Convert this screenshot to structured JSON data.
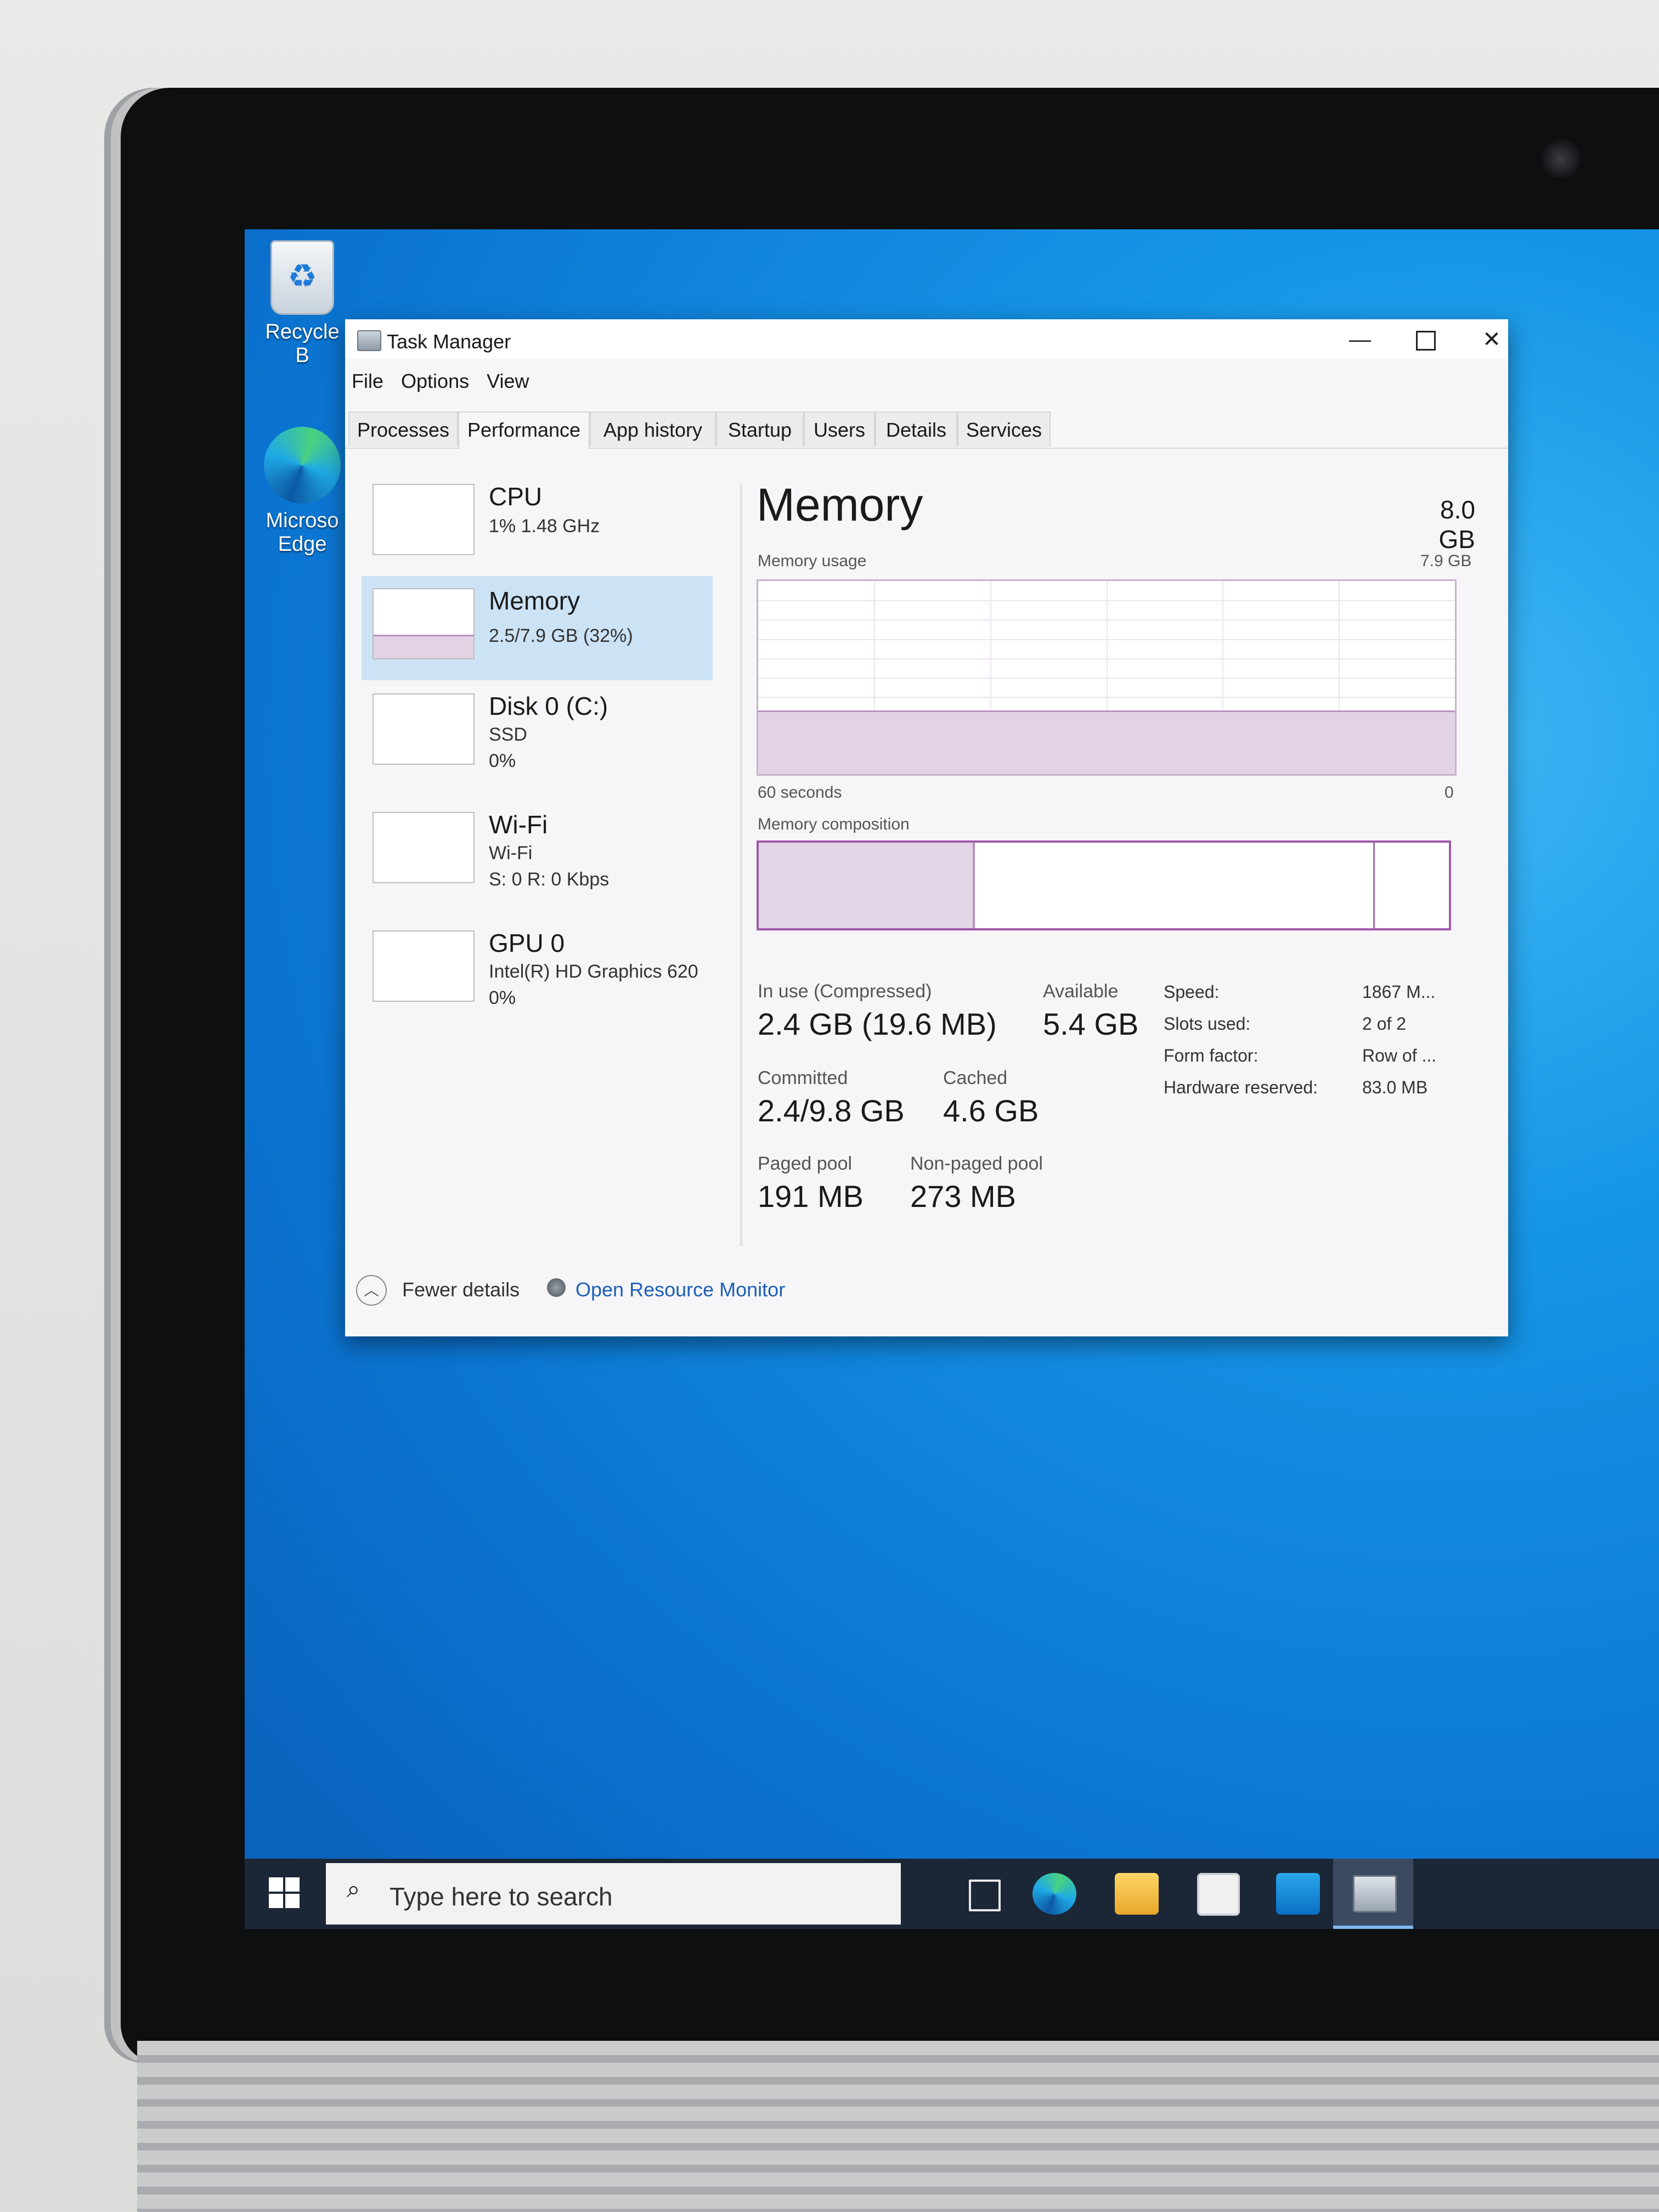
{
  "desktop": {
    "icons": [
      {
        "label": "Recycle B"
      },
      {
        "label": "Microso Edge"
      }
    ]
  },
  "window": {
    "title": "Task Manager",
    "menu": [
      "File",
      "Options",
      "View"
    ],
    "tabs": [
      "Processes",
      "Performance",
      "App history",
      "Startup",
      "Users",
      "Details",
      "Services"
    ],
    "active_tab": "Performance"
  },
  "sidebar": {
    "items": [
      {
        "name": "CPU",
        "line1": "1%  1.48 GHz",
        "line2": ""
      },
      {
        "name": "Memory",
        "line1": "2.5/7.9 GB (32%)",
        "line2": "",
        "selected": true
      },
      {
        "name": "Disk 0 (C:)",
        "line1": "SSD",
        "line2": "0%"
      },
      {
        "name": "Wi-Fi",
        "line1": "Wi-Fi",
        "line2": "S: 0  R: 0 Kbps"
      },
      {
        "name": "GPU 0",
        "line1": "Intel(R) HD Graphics 620",
        "line2": "0%"
      }
    ]
  },
  "memory": {
    "title": "Memory",
    "total": "8.0 GB",
    "usage_label": "Memory usage",
    "usage_max": "7.9 GB",
    "graph_time": "60 seconds",
    "graph_min": "0",
    "usage_fraction": 0.32,
    "composition_label": "Memory composition",
    "composition": {
      "in_use_fraction": 0.31,
      "standby_end_fraction": 0.89
    },
    "stats": {
      "in_use_label": "In use (Compressed)",
      "in_use_value": "2.4 GB (19.6 MB)",
      "available_label": "Available",
      "available_value": "5.4 GB",
      "committed_label": "Committed",
      "committed_value": "2.4/9.8 GB",
      "cached_label": "Cached",
      "cached_value": "4.6 GB",
      "paged_label": "Paged pool",
      "paged_value": "191 MB",
      "nonpaged_label": "Non-paged pool",
      "nonpaged_value": "273 MB"
    },
    "specs": [
      {
        "key": "Speed:",
        "value": "1867 M..."
      },
      {
        "key": "Slots used:",
        "value": "2 of 2"
      },
      {
        "key": "Form factor:",
        "value": "Row of ..."
      },
      {
        "key": "Hardware reserved:",
        "value": "83.0 MB"
      }
    ]
  },
  "footer": {
    "fewer_details": "Fewer details",
    "open_resource_monitor": "Open Resource Monitor"
  },
  "taskbar": {
    "search_placeholder": "Type here to search",
    "icons": [
      "task-view-icon",
      "edge-icon",
      "file-explorer-icon",
      "store-icon",
      "mail-icon",
      "task-manager-icon"
    ]
  },
  "colors": {
    "accent_purple": "#9f5aa8",
    "selected_bg": "#cce3f6",
    "link": "#1d5fb8",
    "taskbar": "#1b2636"
  }
}
